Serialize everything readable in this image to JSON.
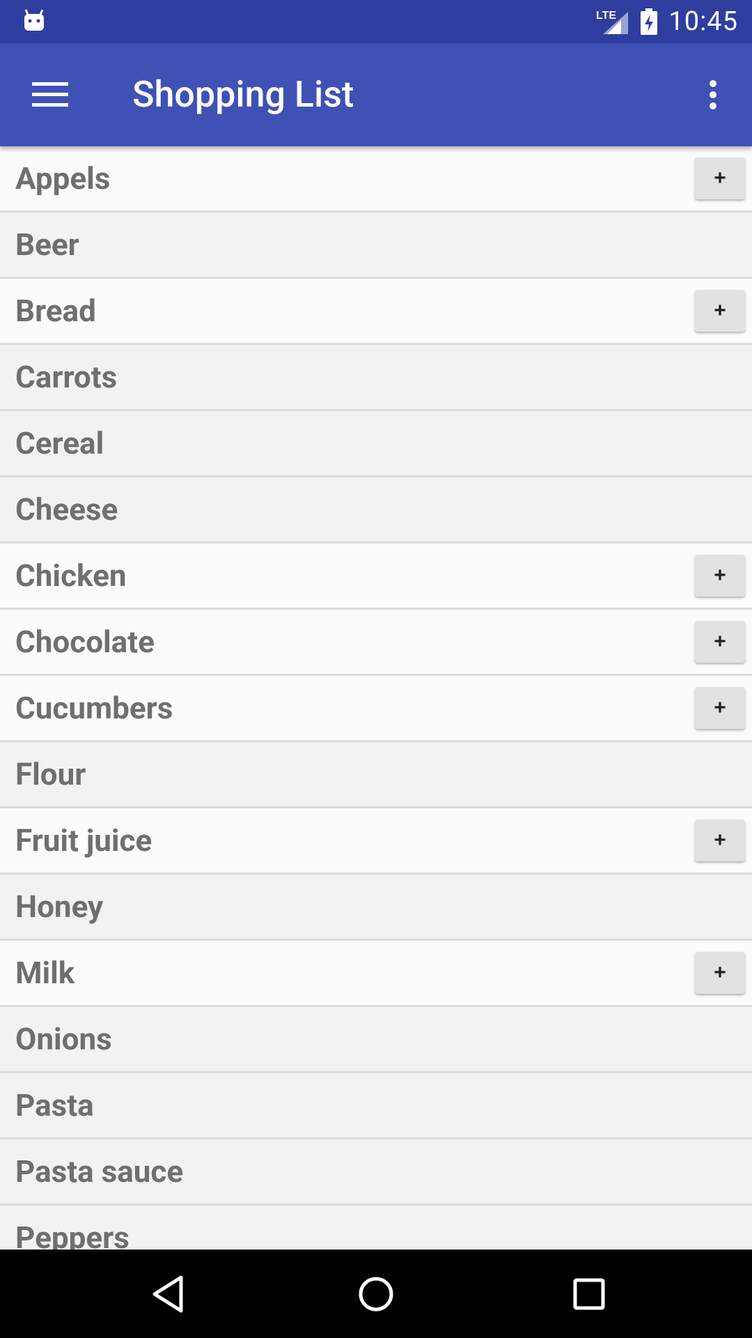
{
  "status_bar": {
    "network_label": "LTE",
    "time": "10:45"
  },
  "app_bar": {
    "title": "Shopping List",
    "menu_icon": "hamburger-menu-icon",
    "overflow_icon": "more-vert-icon"
  },
  "add_button_label": "+",
  "items": [
    {
      "label": "Appels",
      "has_add_button": true
    },
    {
      "label": "Beer",
      "has_add_button": false
    },
    {
      "label": "Bread",
      "has_add_button": true
    },
    {
      "label": "Carrots",
      "has_add_button": false
    },
    {
      "label": "Cereal",
      "has_add_button": false
    },
    {
      "label": "Cheese",
      "has_add_button": false
    },
    {
      "label": "Chicken",
      "has_add_button": true
    },
    {
      "label": "Chocolate",
      "has_add_button": true
    },
    {
      "label": "Cucumbers",
      "has_add_button": true
    },
    {
      "label": "Flour",
      "has_add_button": false
    },
    {
      "label": "Fruit juice",
      "has_add_button": true
    },
    {
      "label": "Honey",
      "has_add_button": false
    },
    {
      "label": "Milk",
      "has_add_button": true
    },
    {
      "label": "Onions",
      "has_add_button": false
    },
    {
      "label": "Pasta",
      "has_add_button": false
    },
    {
      "label": "Pasta sauce",
      "has_add_button": false
    },
    {
      "label": "Peppers",
      "has_add_button": false
    }
  ],
  "colors": {
    "status_bar": "#2f3e9e",
    "app_bar": "#3f51b5",
    "item_text": "#6f6f6f"
  }
}
